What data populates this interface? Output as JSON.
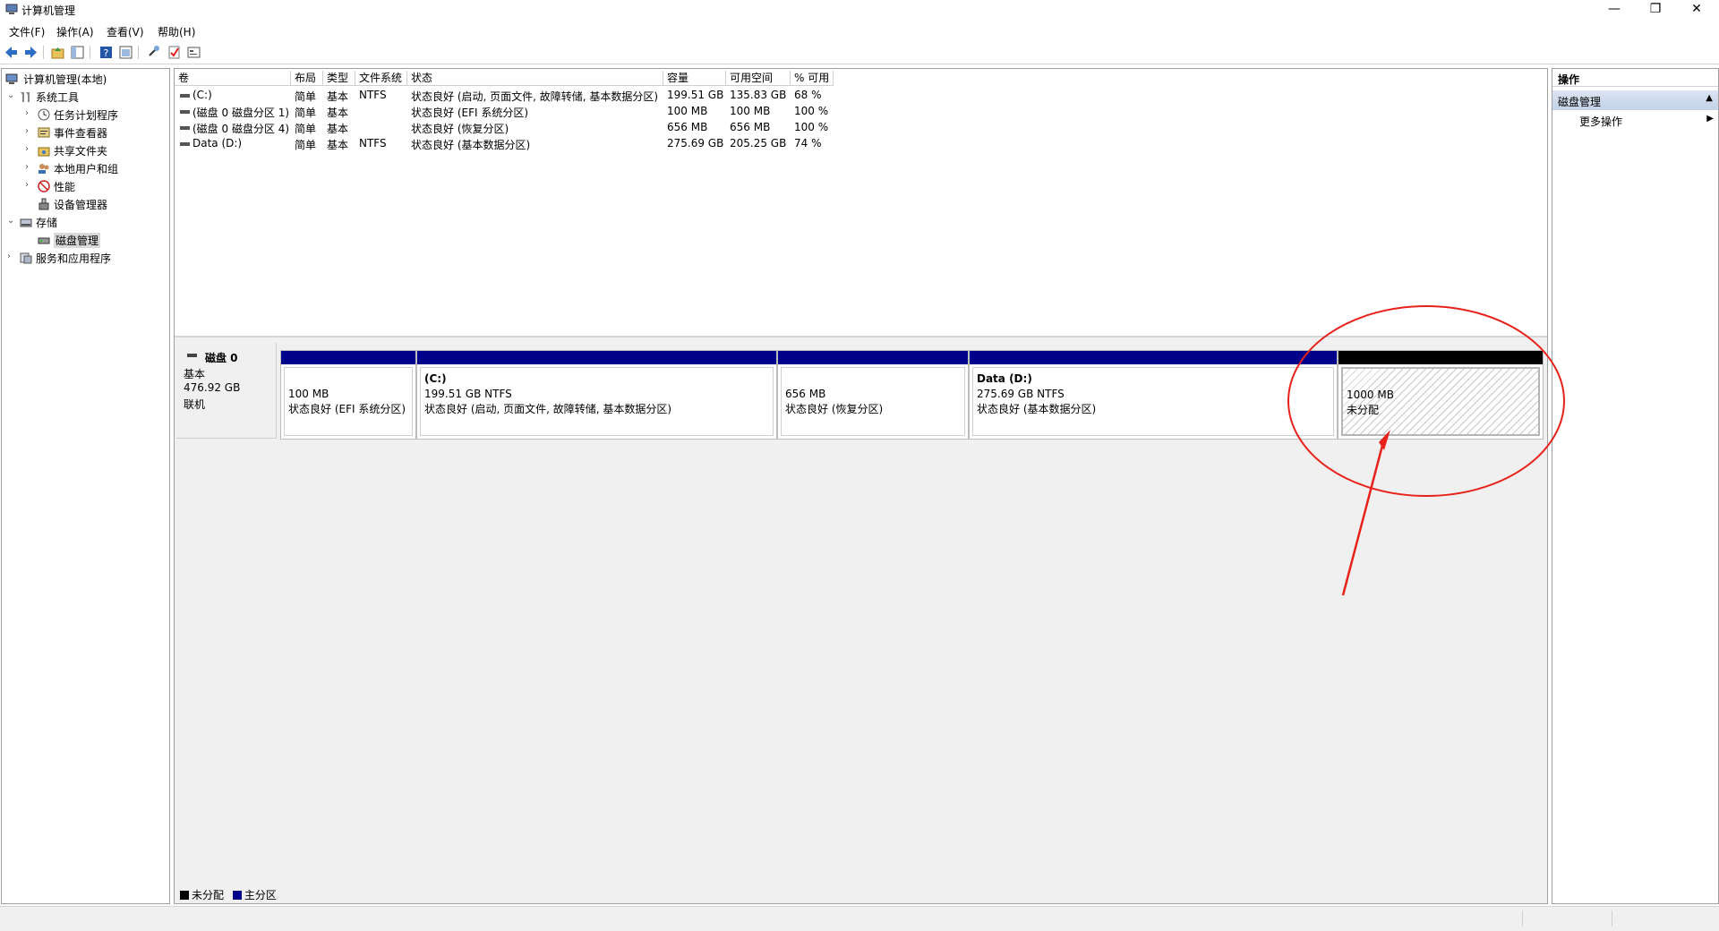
{
  "window": {
    "title": "计算机管理",
    "min": "—",
    "max": "❐",
    "close": "✕"
  },
  "menu": [
    "文件(F)",
    "操作(A)",
    "查看(V)",
    "帮助(H)"
  ],
  "tree": {
    "root": "计算机管理(本地)",
    "system_tools": "系统工具",
    "task_scheduler": "任务计划程序",
    "event_viewer": "事件查看器",
    "shared_folders": "共享文件夹",
    "local_users": "本地用户和组",
    "performance": "性能",
    "device_manager": "设备管理器",
    "storage": "存储",
    "disk_management": "磁盘管理",
    "services_apps": "服务和应用程序"
  },
  "columns": [
    "卷",
    "布局",
    "类型",
    "文件系统",
    "状态",
    "容量",
    "可用空间",
    "% 可用"
  ],
  "volumes": [
    {
      "name": "(C:)",
      "layout": "简单",
      "type": "基本",
      "fs": "NTFS",
      "status": "状态良好 (启动, 页面文件, 故障转储, 基本数据分区)",
      "capacity": "199.51 GB",
      "free": "135.83 GB",
      "pct": "68 %"
    },
    {
      "name": "(磁盘 0 磁盘分区 1)",
      "layout": "简单",
      "type": "基本",
      "fs": "",
      "status": "状态良好 (EFI 系统分区)",
      "capacity": "100 MB",
      "free": "100 MB",
      "pct": "100 %"
    },
    {
      "name": "(磁盘 0 磁盘分区 4)",
      "layout": "简单",
      "type": "基本",
      "fs": "",
      "status": "状态良好 (恢复分区)",
      "capacity": "656 MB",
      "free": "656 MB",
      "pct": "100 %"
    },
    {
      "name": "Data (D:)",
      "layout": "简单",
      "type": "基本",
      "fs": "NTFS",
      "status": "状态良好 (基本数据分区)",
      "capacity": "275.69 GB",
      "free": "205.25 GB",
      "pct": "74 %"
    }
  ],
  "disk": {
    "name": "磁盘 0",
    "type": "基本",
    "size": "476.92 GB",
    "state": "联机"
  },
  "partitions": [
    {
      "name": "",
      "size": "100 MB",
      "status": "状态良好 (EFI 系统分区)"
    },
    {
      "name": "(C:)",
      "size": "199.51 GB NTFS",
      "status": "状态良好 (启动, 页面文件, 故障转储, 基本数据分区)"
    },
    {
      "name": "",
      "size": "656 MB",
      "status": "状态良好 (恢复分区)"
    },
    {
      "name": "Data  (D:)",
      "size": "275.69 GB NTFS",
      "status": "状态良好 (基本数据分区)"
    },
    {
      "name": "",
      "size": "1000 MB",
      "status": "未分配"
    }
  ],
  "legend": {
    "unallocated": "未分配",
    "primary": "主分区"
  },
  "actions": {
    "header": "操作",
    "section": "磁盘管理",
    "more": "更多操作"
  },
  "colors": {
    "primary_bar": "#00008b",
    "unallocated_bar": "#000000",
    "annotation": "#e8221a"
  }
}
